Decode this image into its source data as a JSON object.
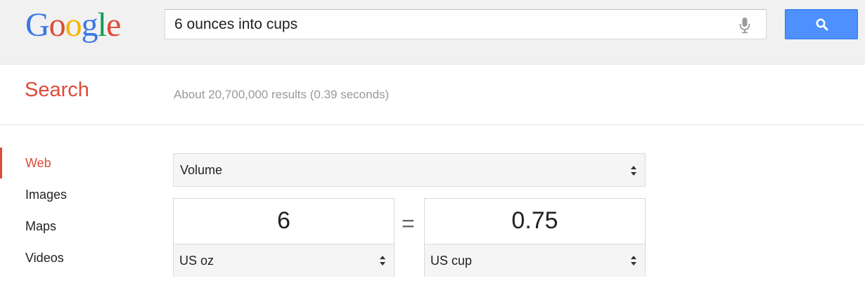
{
  "header": {
    "logo_text": "Google",
    "logo_letters": [
      "G",
      "o",
      "o",
      "g",
      "l",
      "e"
    ],
    "logo_colors": [
      "#3b78e7",
      "#dd4b39",
      "#f4b400",
      "#3b78e7",
      "#0f9d58",
      "#dd4b39"
    ],
    "search_query": "6 ounces into cups",
    "mic_icon": "microphone-icon",
    "search_button_icon": "magnifier-icon",
    "search_button_color": "#4d90fe"
  },
  "results_bar": {
    "title": "Search",
    "stats": "About 20,700,000 results (0.39 seconds)",
    "accent_color": "#dd4b39"
  },
  "nav": {
    "items": [
      {
        "label": "Web",
        "active": true
      },
      {
        "label": "Images",
        "active": false
      },
      {
        "label": "Maps",
        "active": false
      },
      {
        "label": "Videos",
        "active": false
      }
    ]
  },
  "converter": {
    "unit_type": "Volume",
    "from_value": "6",
    "from_unit": "US oz",
    "equals": "=",
    "to_value": "0.75",
    "to_unit": "US cup"
  }
}
